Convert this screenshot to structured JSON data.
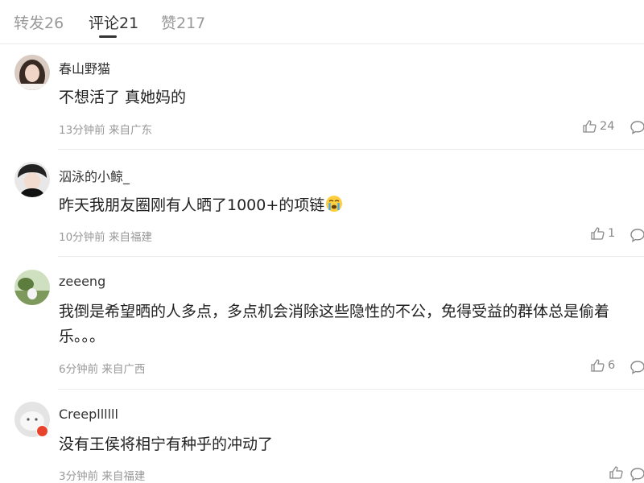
{
  "tabs": [
    {
      "label": "转发26"
    },
    {
      "label": "评论21"
    },
    {
      "label": "赞217"
    }
  ],
  "comments": [
    {
      "username": "春山野猫",
      "text": "不想活了 真她妈的",
      "meta": "13分钟前 来自广东",
      "likes": "24"
    },
    {
      "username": "泅泳的小鲸_",
      "text": "昨天我朋友圈刚有人晒了1000+的项链",
      "meta": "10分钟前 来自福建",
      "likes": "1",
      "emoji": "crying-face-icon"
    },
    {
      "username": "zeeeng",
      "text": "我倒是希望晒的人多点，多点机会消除这些隐性的不公，免得受益的群体总是偷着乐。。。",
      "meta": "6分钟前 来自广西",
      "likes": "6"
    },
    {
      "username": "Creepllllll",
      "text": "没有王侯将相宁有种乎的冲动了",
      "meta": "3分钟前 来自福建",
      "likes": ""
    }
  ],
  "colors": {
    "accent_text": "#333333",
    "muted": "#999999",
    "badge": "#e8432b"
  }
}
